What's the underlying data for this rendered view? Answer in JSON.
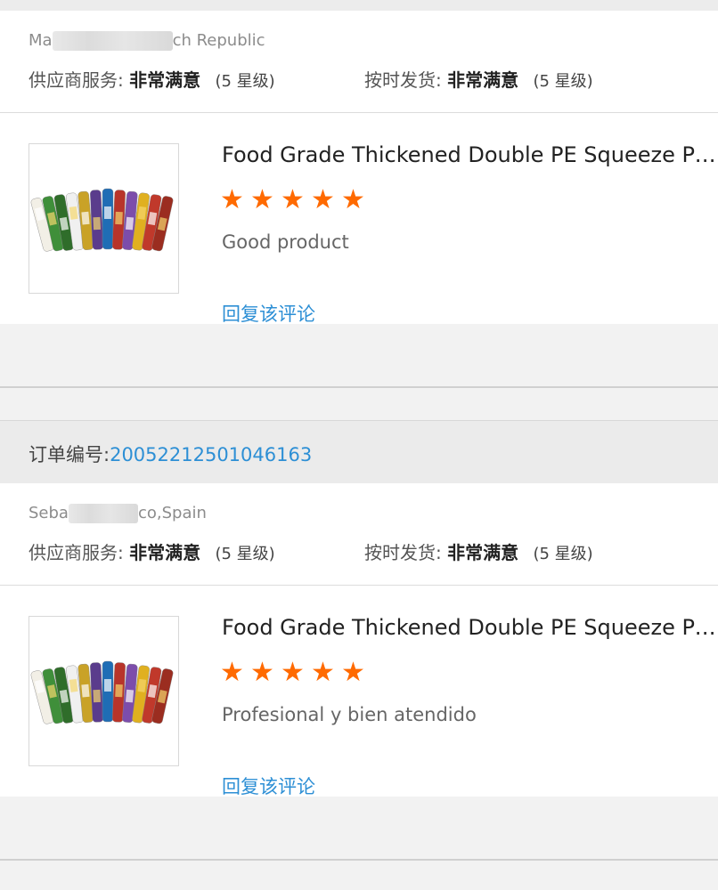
{
  "reviews": [
    {
      "location_prefix": "Ma",
      "location_suffix": "ch Republic",
      "supplier_service_label": "供应商服务:",
      "supplier_service_value": "非常满意",
      "supplier_service_level": "(5 星级)",
      "on_time_label": "按时发货:",
      "on_time_value": "非常满意",
      "on_time_level": "(5 星级)",
      "product_title": "Food Grade Thickened Double PE Squeeze Push Up Tubes",
      "stars": 5,
      "comment": "Good product",
      "reply_label": "回复该评论"
    },
    {
      "location_prefix": "Seba",
      "location_suffix": "co,Spain",
      "supplier_service_label": "供应商服务:",
      "supplier_service_value": "非常满意",
      "supplier_service_level": "(5 星级)",
      "on_time_label": "按时发货:",
      "on_time_value": "非常满意",
      "on_time_level": "(5 星级)",
      "product_title": "Food Grade Thickened Double PE Squeeze Push Up Tubes",
      "stars": 5,
      "comment": "Profesional y bien atendido",
      "reply_label": "回复该评论"
    }
  ],
  "order": {
    "label": "订单编号:",
    "number": "20052212501046163"
  },
  "icons": {
    "star": "star-icon",
    "product_image": "product-thumbnail-tubes"
  },
  "colors": {
    "star": "#ff6a00",
    "link": "#2d8fd5"
  }
}
